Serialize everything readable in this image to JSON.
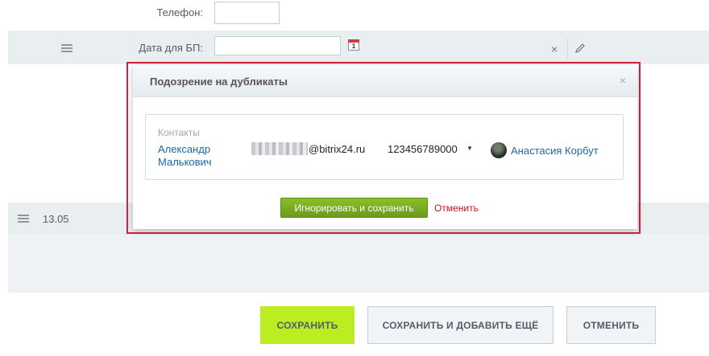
{
  "form": {
    "phone_label": "Телефон:",
    "phone_value": "",
    "bp_date_label": "Дата для БП:",
    "bp_date_value": "",
    "calendar_day": "1",
    "row_remove": "×",
    "date_value": "13.05"
  },
  "popup": {
    "title": "Подозрение на дубликаты",
    "close": "×",
    "entity_type": "Контакты",
    "contact_name": "Александр Малькович",
    "email_suffix": "@bitrix24.ru",
    "phone": "123456789000",
    "phone_caret": "▼",
    "responsible": "Анастасия Корбут",
    "ignore_button": "Игнорировать и сохранить",
    "cancel_link": "Отменить"
  },
  "buttons": {
    "save": "Сохранить",
    "save_add": "Сохранить и добавить ещё",
    "cancel": "Отменить"
  },
  "colors": {
    "highlight_outline": "#d1243a",
    "save_accent": "#bbed21",
    "ignore_green": "#7aab22",
    "link_blue": "#2067b0",
    "cancel_red": "#c0141e"
  }
}
